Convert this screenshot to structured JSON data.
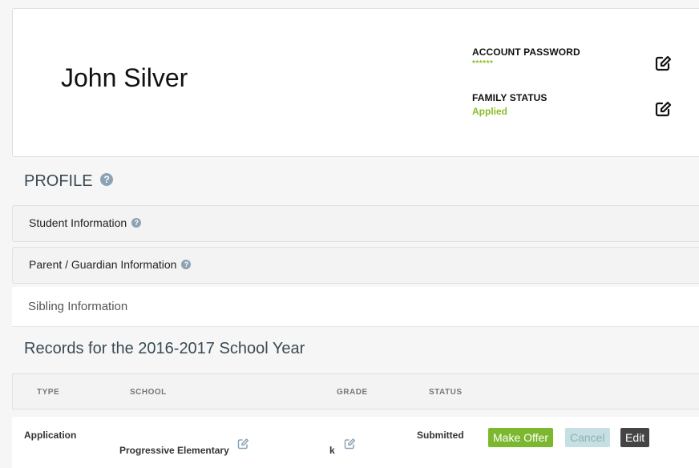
{
  "header": {
    "name": "John Silver",
    "account_password_label": "ACCOUNT PASSWORD",
    "account_password_value": "******",
    "family_status_label": "FAMILY STATUS",
    "family_status_value": "Applied"
  },
  "profile": {
    "title": "PROFILE",
    "panels": [
      {
        "label": "Student Information"
      },
      {
        "label": "Parent / Guardian Information"
      }
    ],
    "sibling_label": "Sibling Information"
  },
  "records": {
    "title": "Records for the 2016-2017 School Year",
    "columns": [
      "TYPE",
      "SCHOOL",
      "GRADE",
      "STATUS"
    ],
    "rows": [
      {
        "type": "Application",
        "school": "Progressive Elementary",
        "grade": "k",
        "status": "Submitted"
      }
    ],
    "actions": {
      "make_offer": "Make Offer",
      "cancel": "Cancel",
      "edit": "Edit"
    }
  },
  "colors": {
    "accent_green": "#7cb82f",
    "status_green": "#8bbd2a",
    "help_icon": "#8ca3b5",
    "title_text": "#3a4a55"
  },
  "icons": {
    "edit": "pencil-square-icon",
    "help": "question-circle-icon"
  }
}
